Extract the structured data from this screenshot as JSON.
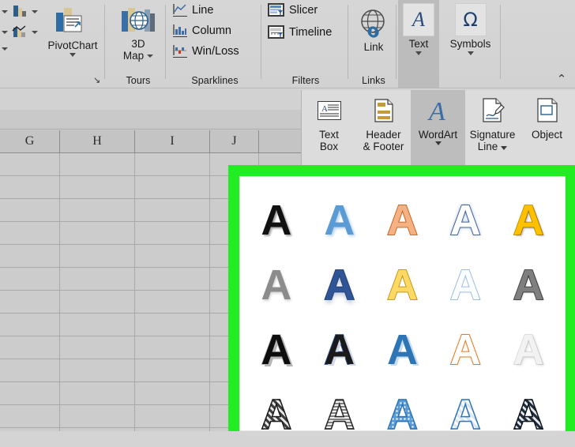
{
  "app": "Microsoft Excel",
  "ribbon": {
    "groups": [
      {
        "name": "charts",
        "label": "",
        "dialog_launcher": "↘"
      },
      {
        "name": "tours",
        "label": "Tours"
      },
      {
        "name": "sparklines",
        "label": "Sparklines"
      },
      {
        "name": "filters",
        "label": "Filters"
      },
      {
        "name": "links",
        "label": "Links"
      },
      {
        "name": "text",
        "label": ""
      },
      {
        "name": "symbols",
        "label": ""
      }
    ],
    "pivotchart": {
      "label": "PivotChart",
      "has_dropdown": true
    },
    "map3d": {
      "label_line1": "3D",
      "label_line2": "Map",
      "has_dropdown": true
    },
    "sparklines": [
      {
        "label": "Line",
        "icon": "sparkline-line-icon"
      },
      {
        "label": "Column",
        "icon": "sparkline-column-icon"
      },
      {
        "label": "Win/Loss",
        "icon": "sparkline-winloss-icon"
      }
    ],
    "filters": [
      {
        "label": "Slicer",
        "icon": "slicer-icon"
      },
      {
        "label": "Timeline",
        "icon": "timeline-icon"
      }
    ],
    "link": {
      "label": "Link",
      "icon": "link-globe-icon"
    },
    "text_button": {
      "label": "Text",
      "glyph": "A",
      "has_dropdown": true,
      "state": "active"
    },
    "symbols_button": {
      "label": "Symbols",
      "glyph": "Ω",
      "has_dropdown": true
    },
    "collapse": {
      "glyph": "⌃"
    }
  },
  "text_panel": {
    "items": [
      {
        "name": "text-box",
        "label_line1": "Text",
        "label_line2": "Box",
        "icon": "text-box-icon",
        "selected": false,
        "has_dropdown": false
      },
      {
        "name": "header-footer",
        "label_line1": "Header",
        "label_line2": "& Footer",
        "icon": "header-footer-icon",
        "selected": false,
        "has_dropdown": false
      },
      {
        "name": "wordart",
        "label_line1": "WordArt",
        "label_line2": "",
        "icon": "wordart-icon",
        "selected": true,
        "has_dropdown": true
      },
      {
        "name": "signature-line",
        "label_line1": "Signature",
        "label_line2": "Line",
        "icon": "signature-line-icon",
        "selected": false,
        "has_dropdown": true
      },
      {
        "name": "object",
        "label_line1": "Object",
        "label_line2": "",
        "icon": "object-icon",
        "selected": false,
        "has_dropdown": false
      }
    ]
  },
  "sheet": {
    "column_headers": [
      "G",
      "H",
      "I",
      "J"
    ],
    "visible_rows": 13
  },
  "wordart_gallery": {
    "letter": "A",
    "highlight_color": "#22ec22",
    "styles": [
      {
        "name": "fill-black-text1-shadow",
        "fill": "#111111",
        "stroke": "none",
        "shadow": "2px 2px 2px rgba(0,0,0,0.35)"
      },
      {
        "name": "fill-blue-accent1-shadow",
        "fill": "#5b9bd5",
        "stroke": "none",
        "shadow": "2px 2px 3px rgba(91,155,213,0.45)"
      },
      {
        "name": "fill-orange-accent2-outline",
        "fill": "#f4b183",
        "stroke": "#c55a11",
        "shadow": "none"
      },
      {
        "name": "fill-white-outline-blue",
        "fill": "#ffffff",
        "stroke": "#2e5496",
        "shadow": "0 0 5px rgba(46,84,150,0.55)"
      },
      {
        "name": "fill-gold-accent4-bevel",
        "fill": "#ffc000",
        "stroke": "#bf9000",
        "shadow": "2px 2px 2px rgba(0,0,0,0.25)"
      },
      {
        "name": "fill-gray-gradient",
        "fill": "#8c8c8c",
        "stroke": "none",
        "shadow": "1px 2px 3px rgba(0,0,0,0.18)"
      },
      {
        "name": "fill-blue-gradient-reflect",
        "fill": "#2f5597",
        "stroke": "#1f3864",
        "shadow": "0 4px 6px rgba(47,85,151,0.35)"
      },
      {
        "name": "fill-gold-outline-gradient",
        "fill": "#ffd966",
        "stroke": "#bf9000",
        "shadow": "none"
      },
      {
        "name": "fill-white-outline-lightblue",
        "fill": "#fbfdff",
        "stroke": "#8eb4e3",
        "shadow": "none"
      },
      {
        "name": "fill-gray-bevel-dark",
        "fill": "#7f7f7f",
        "stroke": "#404040",
        "shadow": "1px 1px 2px rgba(0,0,0,0.3)"
      },
      {
        "name": "fill-black-shadow-gray",
        "fill": "#0d0d0d",
        "stroke": "#bfbfbf",
        "shadow": "3px 3px 0 #b5b5b5"
      },
      {
        "name": "fill-black-outline-blue",
        "fill": "#1a1a1a",
        "stroke": "#2e5496",
        "shadow": "3px 2px 0 #cfd8e8"
      },
      {
        "name": "fill-blue-outline-white",
        "fill": "#2e75b6",
        "stroke": "#ffffff",
        "shadow": "3px 2px 0 #c9dcf0"
      },
      {
        "name": "fill-white-outline-orange",
        "fill": "#ffffff",
        "stroke": "#e36c09",
        "shadow": "0 0 3px rgba(227,108,9,0.3)"
      },
      {
        "name": "fill-white-shadow-light",
        "fill": "#f2f2f2",
        "stroke": "#d9d9d9",
        "shadow": "2px 2px 3px rgba(0,0,0,0.12)"
      },
      {
        "name": "pattern-diagonal-dark",
        "fill": "#3f3f3f",
        "stroke": "#1a1a1a",
        "pattern": "diagonal",
        "shadow": "none"
      },
      {
        "name": "pattern-horizontal-gray",
        "fill": "#808080",
        "stroke": "#262626",
        "pattern": "horizontal",
        "shadow": "none"
      },
      {
        "name": "pattern-dots-blue",
        "fill": "#5b9bd5",
        "stroke": "#2e75b6",
        "pattern": "dots",
        "shadow": "none"
      },
      {
        "name": "pattern-diagonal-lightblue",
        "fill": "#dce6f1",
        "stroke": "#2e75b6",
        "pattern": "diagonal-light",
        "shadow": "none"
      },
      {
        "name": "pattern-diagonal-navy",
        "fill": "#1f2d3d",
        "stroke": "#0d1520",
        "pattern": "diagonal",
        "shadow": "none"
      }
    ]
  }
}
